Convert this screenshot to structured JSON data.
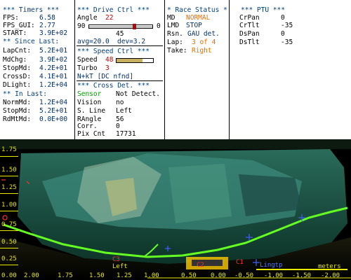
{
  "timers": {
    "header": "*** Timers ***",
    "fps_label": "FPS:",
    "fps": "6.58",
    "fps_gui_label": "FPS_GUI:",
    "fps_gui": "2.77",
    "start_label": "START:",
    "start": "3.9E+02",
    "since_header": "** Since Last:",
    "lapcnt_label": "LapCnt:",
    "lapcnt": "5.2E+01",
    "mdchg_label": "MdChg:",
    "mdchg": "3.9E+02",
    "stopmd_label": "StopMd:",
    "stopmd": "4.2E+01",
    "crossd_label": "CrossD:",
    "crossd": "4.1E+01",
    "dlight_label": "DLight:",
    "dlight": "1.2E+04",
    "inlast_header": "** In Last:",
    "normmd_label": "NormMd:",
    "normmd": "1.2E+04",
    "stopmd2_label": "StopMd:",
    "stopmd2": "5.2E+01",
    "rdmtmd_label": "RdMtMd:",
    "rdmtmd": "0.0E+00"
  },
  "drive": {
    "header": "*** Drive Ctrl ***",
    "angle_label": "Angle",
    "angle": "22",
    "range_left": "90",
    "range_right": "0",
    "range_mid": "45",
    "angle_fraction": 0.73,
    "avg": "avg=20.0",
    "dev": "dev=3.2",
    "speed_header": "*** Speed Ctrl ***",
    "speed_label": "Speed",
    "speed": "48",
    "speed_fraction": 0.72,
    "turbo_label": "Turbo",
    "turbo": "3",
    "nkt": "N+kT [DC nfnd]",
    "cross_header": "*** Cross Det. ***",
    "sensor_label": "Sensor",
    "sensor": "Not Detect.",
    "vision_label": "Vision",
    "vision": "no",
    "sline_label": "S. Line",
    "sline": "Left",
    "rangle_label": "RAngle",
    "rangle": "56",
    "corr_label": "Corr.",
    "corr": "0",
    "pix_label": "Pix Cnt",
    "pix": "17731"
  },
  "race": {
    "header": "* Race Status *",
    "md_label": "MD",
    "md": "NORMAL",
    "lmd_label": "LMD",
    "lmd": "STOP",
    "rsn_label": "Rsn.",
    "rsn": "GAU det.",
    "lap_label": "Lap:",
    "lap": "3 of 4",
    "take_label": "Take:",
    "take": "Right"
  },
  "ptu": {
    "header": "*** PTU ***",
    "crpan_label": "CrPan",
    "crpan": "0",
    "crtlt_label": "CrTlt",
    "crtlt": "-35",
    "dspan_label": "DsPan",
    "dspan": "0",
    "dstlt_label": "DsTlt",
    "dstlt": "-35"
  },
  "camera": {
    "y_ticks": [
      "1.75",
      "1.50",
      "1.25",
      "1.00",
      "0.75",
      "0.50",
      "0.25",
      "0.00"
    ],
    "x_ticks": [
      "2.00",
      "1.75",
      "1.50",
      "1.25",
      "1.00",
      "0.50",
      "0.00",
      "-0.50",
      "-1.00",
      "-1.50",
      "-2.00"
    ],
    "left_label": "Left",
    "lingtp_label": "Lingtp",
    "meters_label": "meters",
    "m_left": "C3",
    "m_mid1": "C2",
    "m_mid2": "C1",
    "colors": {
      "line": "#66ff22",
      "tick": "#e8e800"
    }
  }
}
